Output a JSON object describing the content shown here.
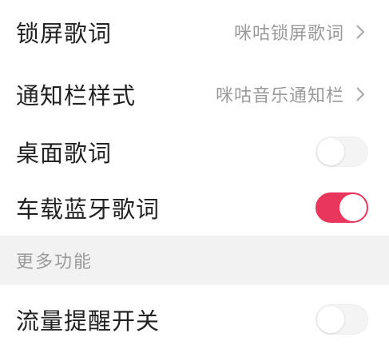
{
  "settings": {
    "lock_screen_lyrics": {
      "label": "锁屏歌词",
      "value": "咪咕锁屏歌词"
    },
    "notification_style": {
      "label": "通知栏样式",
      "value": "咪咕音乐通知栏"
    },
    "desktop_lyrics": {
      "label": "桌面歌词",
      "enabled": false
    },
    "car_bluetooth_lyrics": {
      "label": "车载蓝牙歌词",
      "enabled": true
    }
  },
  "more_section": {
    "title": "更多功能",
    "traffic_reminder": {
      "label": "流量提醒开关",
      "enabled": false
    }
  },
  "colors": {
    "accent": "#e8365d",
    "section_bg": "#f2f2f2",
    "secondary_text": "#9a9a9a"
  },
  "icons": {
    "chevron": "chevron-right-icon"
  }
}
